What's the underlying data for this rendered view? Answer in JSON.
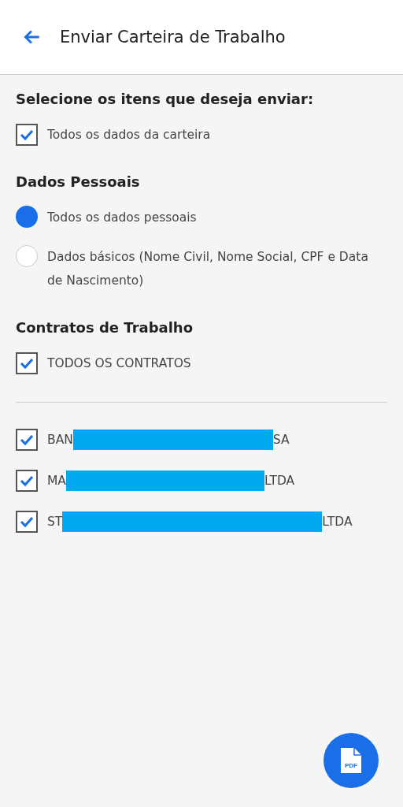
{
  "header": {
    "title": "Enviar Carteira de Trabalho"
  },
  "intro": {
    "title": "Selecione os itens que deseja enviar:",
    "all": {
      "label": "Todos os dados da carteira",
      "checked": true
    }
  },
  "personal": {
    "title": "Dados Pessoais",
    "options": [
      {
        "label": "Todos os dados pessoais",
        "selected": true
      },
      {
        "label": "Dados básicos (Nome Civil, Nome Social, CPF e Data de Nascimento)",
        "selected": false
      }
    ]
  },
  "contracts": {
    "title": "Contratos de Trabalho",
    "all": {
      "label": "TODOS OS CONTRATOS",
      "checked": true
    },
    "items": [
      {
        "prefix": "BAN",
        "suffix": "SA",
        "checked": true
      },
      {
        "prefix": "MA",
        "suffix": "LTDA",
        "checked": true
      },
      {
        "prefix": "ST",
        "suffix": "LTDA",
        "checked": true
      }
    ]
  },
  "fab": {
    "label": "PDF"
  }
}
